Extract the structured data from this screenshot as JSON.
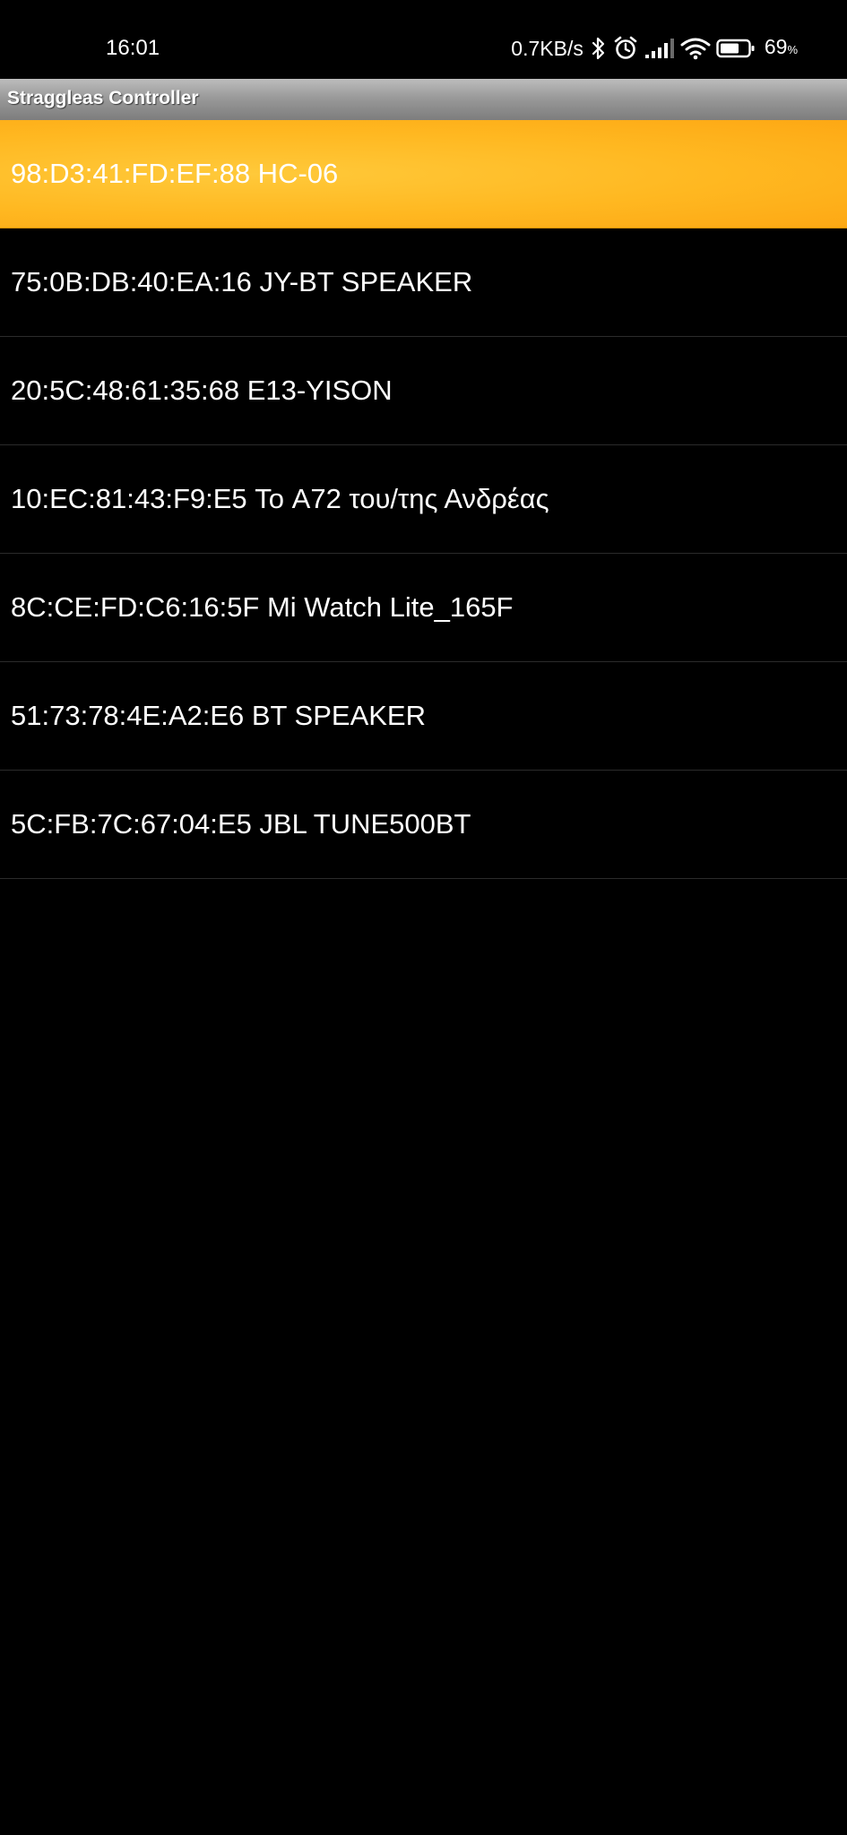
{
  "status_bar": {
    "time": "16:01",
    "net_speed": "0.7KB/s",
    "battery_percent": "69",
    "battery_unit": "%",
    "icons": [
      "bluetooth-icon",
      "alarm-icon",
      "signal-icon",
      "wifi-icon",
      "battery-icon"
    ],
    "battery_level": 0.69
  },
  "app": {
    "title": "Straggleas Controller",
    "accent_color": "#ffb821"
  },
  "devices": [
    {
      "label": "98:D3:41:FD:EF:88 HC-06",
      "selected": true
    },
    {
      "label": "75:0B:DB:40:EA:16 JY-BT SPEAKER",
      "selected": false
    },
    {
      "label": "20:5C:48:61:35:68 E13-YISON",
      "selected": false
    },
    {
      "label": "10:EC:81:43:F9:E5 Το A72 του/της Ανδρέας",
      "selected": false
    },
    {
      "label": "8C:CE:FD:C6:16:5F Mi Watch Lite_165F",
      "selected": false
    },
    {
      "label": "51:73:78:4E:A2:E6 BT SPEAKER",
      "selected": false
    },
    {
      "label": "5C:FB:7C:67:04:E5 JBL TUNE500BT",
      "selected": false
    }
  ]
}
